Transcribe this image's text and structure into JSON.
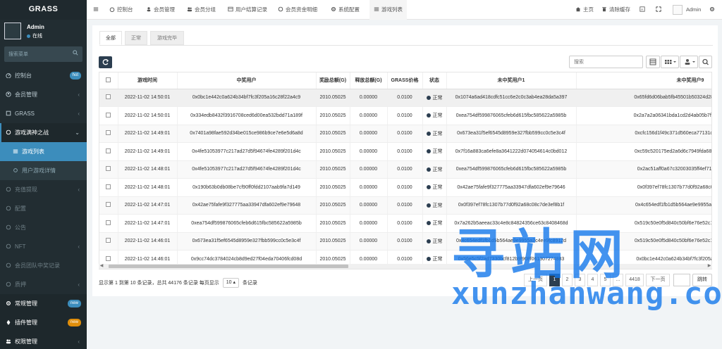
{
  "brand": "GRASS",
  "user": {
    "name": "Admin",
    "status": "在线"
  },
  "sidebar": {
    "search_placeholder": "搜索菜单",
    "items": [
      {
        "label": "控制台",
        "badge": "hot",
        "badge_color": "#3c8dbc"
      },
      {
        "label": "会员管理"
      },
      {
        "label": "GRASS"
      },
      {
        "label": "游戏满神之战"
      },
      {
        "label": "游戏列表"
      },
      {
        "label": "用户游戏详情"
      },
      {
        "label": "充值提现"
      },
      {
        "label": "配置"
      },
      {
        "label": "公告"
      },
      {
        "label": "NFT"
      },
      {
        "label": "会员团队中奖记录"
      },
      {
        "label": "质押"
      },
      {
        "label": "常规管理",
        "badge": "new",
        "badge_color": "#3c8dbc"
      },
      {
        "label": "插件管理",
        "badge": "new",
        "badge_color": "#e08e0b"
      },
      {
        "label": "权限管理"
      }
    ]
  },
  "topnav": {
    "items": [
      "控制台",
      "会员管理",
      "会员分组",
      "用户结算记录",
      "会员资金明细",
      "系统配置",
      "游戏列表"
    ],
    "home": "主页",
    "clear_cache": "清除缓存",
    "user": "Admin"
  },
  "tabs": [
    "全部",
    "正常",
    "游戏完毕"
  ],
  "toolbar": {
    "search_placeholder": "搜索"
  },
  "table": {
    "headers": [
      "游戏时间",
      "中奖用户",
      "奖励总额(G)",
      "释放总额(G)",
      "GRASS价格",
      "状态",
      "未中奖用户1",
      "未中奖用户9"
    ],
    "rows": [
      [
        "2022-11-02 14:50:01",
        "0x0bc1e442c0a624b34bf7fc3f205a16c28f22a4c9",
        "2010.05025",
        "0.00000",
        "0.0100",
        "正常",
        "0x1074a6ad418cdfc51cc6e2c0c3ab4ea28da5a397",
        "0x65fd6d06bab5fb45501b50324d28d2d6b790b6e5"
      ],
      [
        "2022-11-02 14:50:01",
        "0x334edb8432f3916708ced6d00ea532bdd71a189f",
        "2010.05025",
        "0.00000",
        "0.0100",
        "正常",
        "0xea754df599876065cfeb6d615fbc585622a5985b",
        "0x2a7a2a06341bda1cd2d4ab05b7f56b0dbe4a2d92"
      ],
      [
        "2022-11-02 14:49:01",
        "0x7401a98fae592d34be015ce986b9ce7e6e5d6a8d",
        "2010.05025",
        "0.00000",
        "0.0100",
        "正常",
        "0x673ea31f5ef6545d8959e327fbb599cc0c5e3c4f",
        "0xcfc156d1f49c371d560eca77131da38a55c074ab"
      ],
      [
        "2022-11-02 14:49:01",
        "0x4fe51053977c217ad27d5f94674fe4289f201d4c",
        "2010.05025",
        "0.00000",
        "0.0100",
        "正常",
        "0x7f16a883ca6efe8a3641222d074054614c0bd012",
        "0xc59c520175ed2a6d6c7949fda6806019f8a636e7"
      ],
      [
        "2022-11-02 14:48:01",
        "0x4fe51053977c217ad27d5f94674fe4289f201d4c",
        "2010.05025",
        "0.00000",
        "0.0100",
        "正常",
        "0xea754df599876065cfeb6d615fbc585622a5985b",
        "0x2ac51aff0a67c32003035ff4ef71dd1e5598f0b2"
      ],
      [
        "2022-11-02 14:48:01",
        "0x190b63b0db08be7cf90ff0fdd2107aab9fa7d149",
        "2010.05025",
        "0.00000",
        "0.0100",
        "正常",
        "0x42ae75fafe9f327775aa33947dfa602ef9e79646",
        "0x0f397ef78fc1307b77d0f92a68c08c7de3ef8b1f"
      ],
      [
        "2022-11-02 14:47:01",
        "0x42ae75fafe9f327775aa33947dfa602ef9e79648",
        "2010.05025",
        "0.00000",
        "0.0100",
        "正常",
        "0x0f397ef78fc1307b77d0f92a68c08c7de3ef8b1f",
        "0x4c654edf1fb1d5b564ae9e9955a2c4ee9fc8912d"
      ],
      [
        "2022-11-02 14:47:01",
        "0xea754df599876065cfeb6d615fbc585622a5985b",
        "2010.05025",
        "0.00000",
        "0.0100",
        "正常",
        "0x7a262b5aeeac33c4e8c84824356ce63c8408468d",
        "0x519c50e0f5d840c50bf6e76e52c1273a55b6d430"
      ],
      [
        "2022-11-02 14:46:01",
        "0x673ea31f5ef6545d8959e327fbb599cc0c5e3c4f",
        "2010.05025",
        "0.00000",
        "0.0100",
        "正常",
        "0x4c654edf1fb1d5b564ae9e9955a2c4ee9fc8912d",
        "0x519c50e0f5d840c50bf6e76e52c1273a55b6d430"
      ],
      [
        "2022-11-02 14:46:01",
        "0x9cc74dc3784024cb8d9ed27f04eda70406fcd08d",
        "2010.05025",
        "0.00000",
        "0.0100",
        "正常",
        "0x56e5c5f2ad7330bcf812b9f908f061307274883",
        "0x0bc1e442c0a624b34bf7fc3f205a16c28f22a4c9"
      ]
    ]
  },
  "pagination": {
    "info_pre": "显示第 1 到第 10 条记录，总共 44176 条记录 每页显示",
    "page_size": "10",
    "info_post": "条记录",
    "prev": "上一页",
    "pages": [
      "1",
      "2",
      "3",
      "4",
      "5",
      "...",
      "4418"
    ],
    "next": "下一页",
    "go": "跳转"
  },
  "watermark": {
    "cn": "寻站网",
    "en": "xunzhanwang.com"
  }
}
